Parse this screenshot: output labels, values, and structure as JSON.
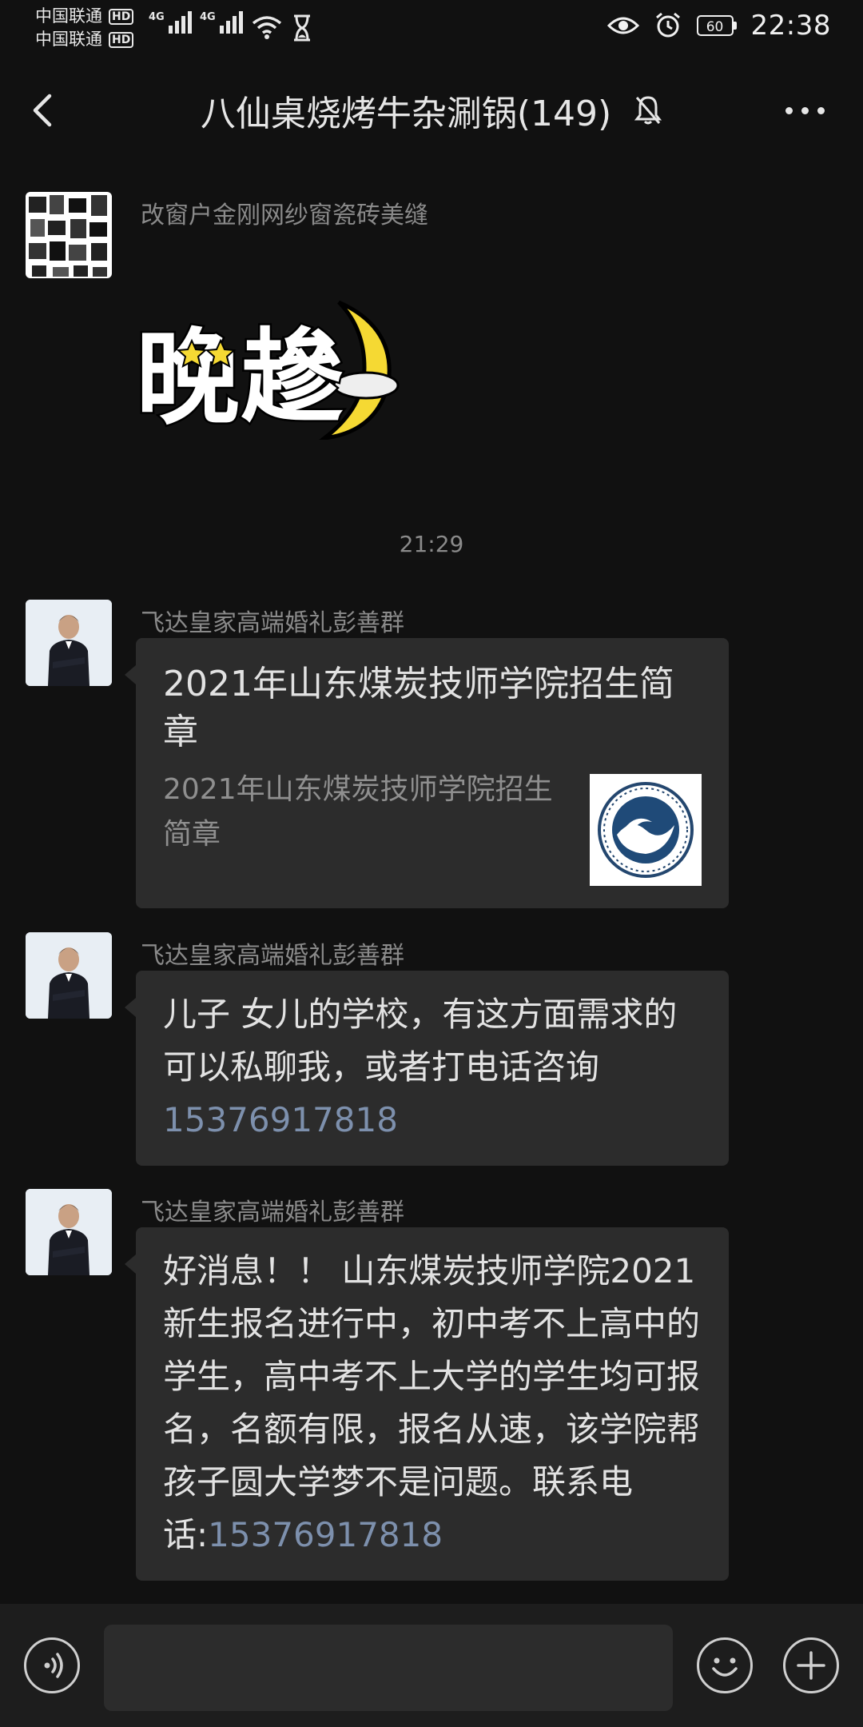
{
  "status": {
    "carrier1": "中国联通",
    "carrier2": "中国联通",
    "hd": "HD",
    "net1": "4G",
    "net2": "4G",
    "battery": "60",
    "time": "22:38"
  },
  "header": {
    "title": "八仙桌烧烤牛杂涮锅(149)"
  },
  "messages": [
    {
      "sender": "改窗户金刚网纱窗瓷砖美缝",
      "sticker_text": "晚䟃"
    },
    {
      "time": "21:29"
    },
    {
      "sender": "飞达皇家高端婚礼彭善群",
      "card_title": "2021年山东煤炭技师学院招生简章",
      "card_desc": "2021年山东煤炭技师学院招生简章"
    },
    {
      "sender": "飞达皇家高端婚礼彭善群",
      "text": "儿子 女儿的学校，有这方面需求的可以私聊我，或者打电话咨询",
      "phone": "15376917818"
    },
    {
      "sender": "飞达皇家高端婚礼彭善群",
      "text": "好消息！！ 山东煤炭技师学院2021 新生报名进行中，初中考不上高中的学生，高中考不上大学的学生均可报名，名额有限，报名从速，该学院帮孩子圆大学梦不是问题。联系电话:",
      "phone": "15376917818"
    }
  ],
  "icons": {
    "back": "back-arrow-icon",
    "mute": "bell-off-icon",
    "more": "more-dots-icon",
    "voice": "voice-icon",
    "emoji": "emoji-icon",
    "plus": "plus-icon"
  },
  "colors": {
    "background": "#111111",
    "bubble": "#2c2c2c",
    "link": "#7d90ad"
  }
}
